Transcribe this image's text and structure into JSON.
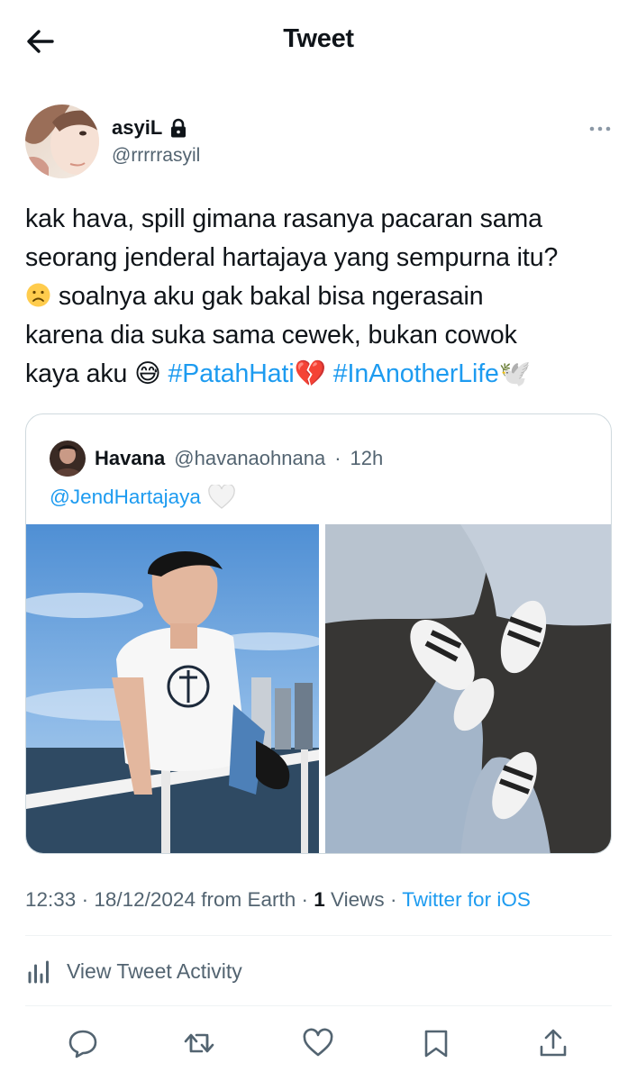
{
  "header": {
    "title": "Tweet",
    "back_icon": "arrow-left-icon"
  },
  "author": {
    "name": "asyiL",
    "handle": "@rrrrrasyil",
    "protected": true
  },
  "tweet": {
    "line1": "kak hava, spill gimana rasanya pacaran sama",
    "line2": "seorang jenderal hartajaya yang sempurna itu?",
    "line3_emoji": "🙁",
    "line3_text": " soalnya aku gak bakal bisa ngerasain",
    "line4": "karena dia suka sama cewek, bukan cowok",
    "line5_text": "kaya aku ",
    "line5_emoji": "😅",
    "hashtag1": "#PatahHati",
    "hashtag1_emoji": "💔",
    "hashtag2": "#InAnotherLife",
    "hashtag2_emoji": "🕊️"
  },
  "quote": {
    "name": "Havana",
    "handle": "@havanaohnana",
    "separator": "·",
    "time": "12h",
    "mention": "@JendHartajaya",
    "mention_emoji": "🤍"
  },
  "meta": {
    "time": "12:33",
    "sep1": "·",
    "date": "18/12/2024 from Earth",
    "sep2": "·",
    "views_count": "1",
    "views_label": "Views",
    "sep3": "·",
    "source": "Twitter for iOS"
  },
  "activity": {
    "label": "View Tweet Activity"
  },
  "actions": [
    "reply-icon",
    "retweet-icon",
    "like-icon",
    "bookmark-icon",
    "share-icon"
  ],
  "colors": {
    "accent": "#1d9bf0",
    "text": "#0f1419",
    "secondary": "#536471",
    "border": "#cfd9de"
  }
}
